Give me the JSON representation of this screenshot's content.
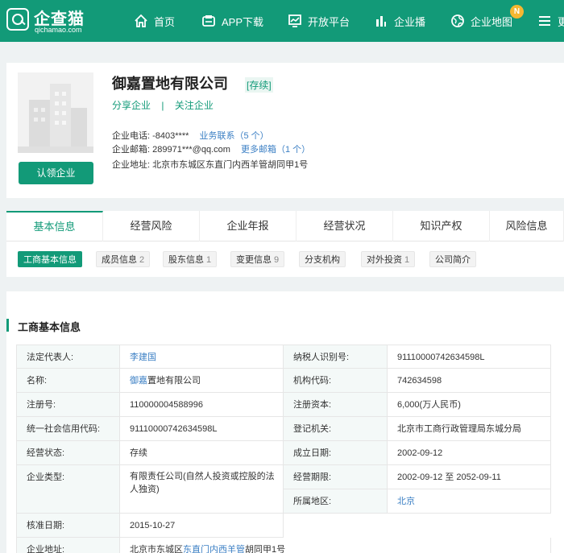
{
  "nav": {
    "logo_name": "企查猫",
    "logo_sub": "qichamao.com",
    "items": [
      {
        "label": "首页",
        "icon": "home-icon"
      },
      {
        "label": "APP下载",
        "icon": "app-download-icon"
      },
      {
        "label": "开放平台",
        "icon": "open-platform-icon"
      },
      {
        "label": "企业播",
        "icon": "enterprise-broadcast-icon"
      },
      {
        "label": "企业地图",
        "icon": "map-globe-icon"
      },
      {
        "label": "更",
        "icon": "menu-icon"
      }
    ],
    "badge": "N",
    "color": "#129a78"
  },
  "company": {
    "name": "御嘉置地有限公司",
    "status": "[存续]",
    "share": "分享企业",
    "separator": "|",
    "follow": "关注企业",
    "claim": "认领企业",
    "phone_label": "企业电话:",
    "phone": "-8403****",
    "phone_link": "业务联系（5 个）",
    "email_label": "企业邮箱:",
    "email": "289971***@qq.com",
    "email_link": "更多邮箱（1 个）",
    "address_label": "企业地址:",
    "address": "北京市东城区东直门内西羊管胡同甲1号"
  },
  "tabs": [
    "基本信息",
    "经营风险",
    "企业年报",
    "经营状况",
    "知识产权",
    "风险信息"
  ],
  "subtabs": [
    {
      "label": "工商基本信息",
      "count": ""
    },
    {
      "label": "成员信息",
      "count": "2"
    },
    {
      "label": "股东信息",
      "count": "1"
    },
    {
      "label": "变更信息",
      "count": "9"
    },
    {
      "label": "分支机构",
      "count": ""
    },
    {
      "label": "对外投资",
      "count": "1"
    },
    {
      "label": "公司简介",
      "count": ""
    }
  ],
  "section": {
    "title": "工商基本信息",
    "rows": {
      "legal_rep_label": "法定代表人:",
      "legal_rep": "李建国",
      "taxpayer_label": "纳税人识别号:",
      "taxpayer": "91110000742634598L",
      "name_label": "名称:",
      "name_link": "御嘉",
      "name_rest": "置地有限公司",
      "org_code_label": "机构代码:",
      "org_code": "742634598",
      "reg_no_label": "注册号:",
      "reg_no": "110000004588996",
      "capital_label": "注册资本:",
      "capital": "6,000(万人民币)",
      "credit_label": "统一社会信用代码:",
      "credit": "91110000742634598L",
      "authority_label": "登记机关:",
      "authority": "北京市工商行政管理局东城分局",
      "op_status_label": "经营状态:",
      "op_status": "存续",
      "founded_label": "成立日期:",
      "founded": "2002-09-12",
      "type_label": "企业类型:",
      "type": "有限责任公司(自然人投资或控股的法人独资)",
      "term_label": "经营期限:",
      "term": "2002-09-12 至 2052-09-11",
      "region_label": "所属地区:",
      "region": "北京",
      "approved_label": "核准日期:",
      "approved": "2015-10-27",
      "address_label": "企业地址:",
      "address_a": "北京市东城区",
      "address_b": "东直门内西羊管",
      "address_c": "胡同甲1号"
    }
  }
}
